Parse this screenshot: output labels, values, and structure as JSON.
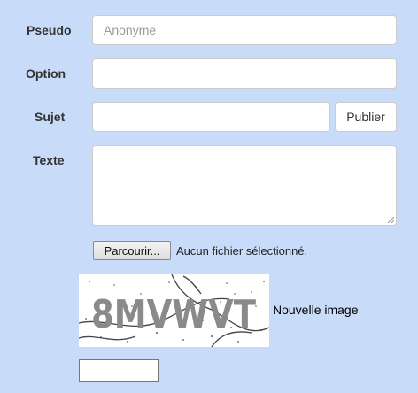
{
  "form": {
    "pseudo": {
      "label": "Pseudo",
      "placeholder": "Anonyme",
      "value": ""
    },
    "option": {
      "label": "Option",
      "value": ""
    },
    "sujet": {
      "label": "Sujet",
      "value": ""
    },
    "publish_label": "Publier",
    "texte": {
      "label": "Texte",
      "value": ""
    },
    "file": {
      "button_label": "Parcourir...",
      "status": "Aucun fichier sélectionné."
    },
    "captcha": {
      "text": "8MVWVT",
      "refresh_label": "Nouvelle image",
      "input_value": ""
    }
  }
}
